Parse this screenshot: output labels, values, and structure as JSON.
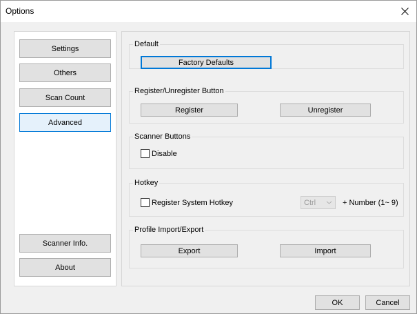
{
  "window": {
    "title": "Options"
  },
  "nav": {
    "items": [
      {
        "label": "Settings"
      },
      {
        "label": "Others"
      },
      {
        "label": "Scan Count"
      },
      {
        "label": "Advanced",
        "selected": true
      }
    ],
    "bottom_items": [
      {
        "label": "Scanner Info."
      },
      {
        "label": "About"
      }
    ]
  },
  "groups": {
    "default": {
      "title": "Default",
      "factory_defaults_label": "Factory Defaults"
    },
    "register": {
      "title": "Register/Unregister Button",
      "register_label": "Register",
      "unregister_label": "Unregister"
    },
    "scanner_buttons": {
      "title": "Scanner Buttons",
      "disable_label": "Disable",
      "disable_checked": false
    },
    "hotkey": {
      "title": "Hotkey",
      "register_hotkey_label": "Register System Hotkey",
      "register_hotkey_checked": false,
      "modifier_value": "Ctrl",
      "number_label": "+  Number (1⁠~ 9)"
    },
    "profile": {
      "title": "Profile Import/Export",
      "export_label": "Export",
      "import_label": "Import"
    }
  },
  "footer": {
    "ok_label": "OK",
    "cancel_label": "Cancel"
  },
  "colors": {
    "accent": "#0078d7",
    "selected_bg": "#e5f1fb",
    "button_bg": "#e1e1e1",
    "window_bg": "#f0f0f0"
  },
  "icons": {
    "close": "close-icon",
    "dropdown": "chevron-down-icon"
  }
}
